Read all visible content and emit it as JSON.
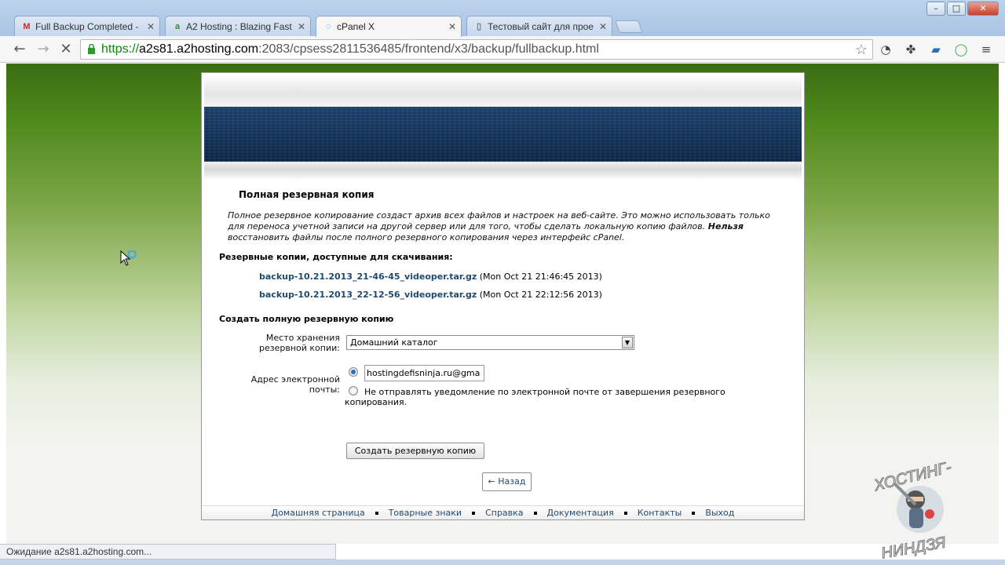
{
  "browser": {
    "tabs": [
      {
        "label": "Full Backup Completed - ",
        "icon": "gmail-icon"
      },
      {
        "label": "A2 Hosting : Blazing Fast ",
        "icon": "a2-icon"
      },
      {
        "label": "cPanel X",
        "icon": "loading-icon"
      },
      {
        "label": "Тестовый сайт для прое",
        "icon": "page-icon"
      }
    ],
    "url_scheme": "https://",
    "url_host": "a2s81.a2hosting.com",
    "url_path": ":2083/cpsess2811536485/frontend/x3/backup/fullbackup.html",
    "status_text": "Ожидание a2s81.a2hosting.com..."
  },
  "page": {
    "title": "Полная резервная копия",
    "description_pre": "Полное резервное копирование создаст архив всех файлов и настроек на веб-сайте. Это можно использовать только для переноса учетной записи на другой сервер или для того, чтобы сделать локальную копию файлов.",
    "description_bold": "Нельзя",
    "description_post": "восстановить файлы после полного резервного копирования через интерфейс cPanel.",
    "downloads_heading": "Резервные копии, доступные для скачивания:",
    "backups": [
      {
        "file": "backup-10.21.2013_21-46-45_videoper.tar.gz",
        "date": "(Mon Oct 21 21:46:45 2013)"
      },
      {
        "file": "backup-10.21.2013_22-12-56_videoper.tar.gz",
        "date": "(Mon Oct 21 22:12:56 2013)"
      }
    ],
    "create_heading": "Создать полную резервную копию",
    "destination_label_1": "Место хранения",
    "destination_label_2": "резервной копии:",
    "destination_value": "Домашний каталог",
    "email_label_1": "Адрес электронной",
    "email_label_2": "почты:",
    "email_value": "hostingdefisninja.ru@gma",
    "no_email_label": "Не отправлять уведомление по электронной почте от завершения резервного копирования.",
    "submit_label": "Создать резервную копию",
    "back_label": "← Назад",
    "footer_links": [
      "Домашняя страница",
      "Товарные знаки",
      "Справка",
      "Документация",
      "Контакты",
      "Выход"
    ]
  },
  "watermark": {
    "line1": "ХОСТИНГ-",
    "line2": "НИНДЗЯ"
  },
  "colors": {
    "link": "#1f4a6e",
    "banner": "#0c2746",
    "accent_green": "#4f8a1c"
  }
}
